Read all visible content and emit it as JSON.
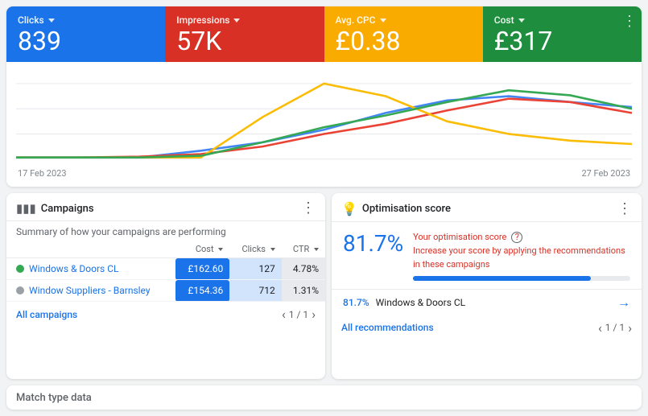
{
  "metrics": [
    {
      "id": "clicks",
      "label": "Clicks",
      "value": "839",
      "color": "blue"
    },
    {
      "id": "impressions",
      "label": "Impressions",
      "value": "57K",
      "color": "red"
    },
    {
      "id": "avg_cpc",
      "label": "Avg. CPC",
      "value": "£0.38",
      "color": "yellow"
    },
    {
      "id": "cost",
      "label": "Cost",
      "value": "£317",
      "color": "green"
    }
  ],
  "chart": {
    "date_start": "17 Feb 2023",
    "date_end": "27 Feb 2023"
  },
  "campaigns_panel": {
    "title": "Campaigns",
    "subtitle": "Summary of how your campaigns are performing",
    "columns": [
      "Cost",
      "Clicks",
      "CTR"
    ],
    "rows": [
      {
        "name": "Windows & Doors CL",
        "dot": "green",
        "cost": "£162.60",
        "clicks": "127",
        "ctr": "4.78%"
      },
      {
        "name": "Window Suppliers - Barnsley",
        "dot": "gray",
        "cost": "£154.36",
        "clicks": "712",
        "ctr": "1.31%"
      }
    ],
    "all_link": "All campaigns",
    "pagination": "1 / 1"
  },
  "optimisation_panel": {
    "title": "Optimisation score",
    "score": "81.7%",
    "description_main": "Your optimisation score",
    "description_sub": "Increase your score by applying the recommendations in these campaigns",
    "campaign_score": "81.7%",
    "campaign_name": "Windows & Doors CL",
    "all_link": "All recommendations",
    "pagination": "1 / 1",
    "progress_pct": 81.7
  },
  "bottom_panel": {
    "title": "Match type data"
  },
  "icons": {
    "more_vert": "⋮",
    "chevron_down": "▾",
    "bar_chart": "▮▮▮",
    "bulb": "💡",
    "arrow_right": "→",
    "arrow_prev": "‹",
    "arrow_next": "›"
  }
}
